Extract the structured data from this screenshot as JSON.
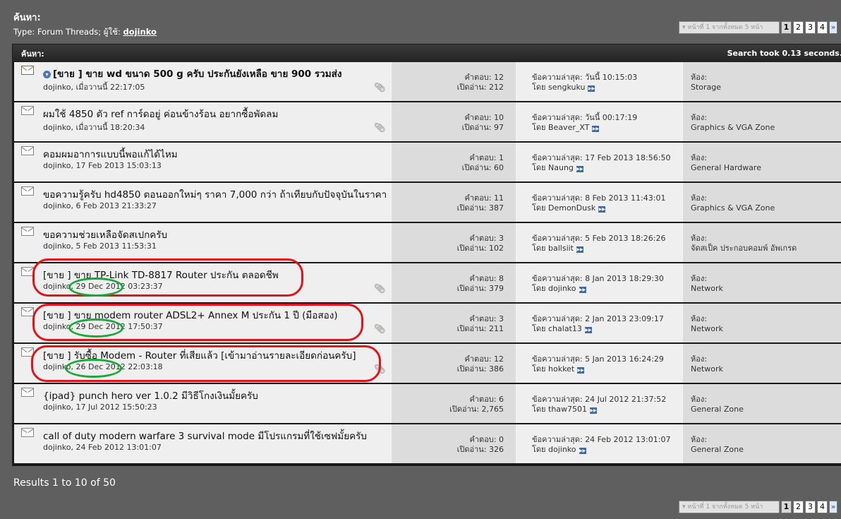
{
  "header": {
    "title": "ค้นหา:",
    "subtitle_prefix": "Type: Forum Threads; ผู้ใช้:",
    "user": "dojinko"
  },
  "pager": {
    "page_text": "หน้าที่ 1 จากทั้งหมด 5 หน้า",
    "pages": [
      "1",
      "2",
      "3",
      "4"
    ],
    "current": "1",
    "next": "»"
  },
  "box": {
    "title": "ค้นหา:",
    "search_time": "Search took 0.13 seconds."
  },
  "labels": {
    "replies": "คำตอบ:",
    "views": "เปิดอ่าน:",
    "last_post": "ข้อความล่าสุด:",
    "by": "โดย",
    "forum": "ห้อง:"
  },
  "threads": [
    {
      "title": "[ขาย ] ขาย wd ขนาด 500 g ครับ ประกันยังเหลือ ขาย 900 รวมส่ง",
      "bold": true,
      "byline": "dojinko, เมื่อวานนี้ 22:17:05",
      "replies": "12",
      "views": "212",
      "last_time": "วันนี้ 10:15:03",
      "last_user": "sengkuku",
      "forum": "Storage",
      "attach": true
    },
    {
      "title": "ผมใช้ 4850 ตัว ref การ์ดอยู่ ค่อนข้างร้อน อยากซื้อพัดลม",
      "byline": "dojinko, เมื่อวานนี้ 18:20:34",
      "replies": "10",
      "views": "97",
      "last_time": "วันนี้ 00:17:19",
      "last_user": "Beaver_XT",
      "forum": "Graphics & VGA Zone",
      "attach": true
    },
    {
      "title": "คอมผมอาการแบบนี้พอแก้ได้ไหม",
      "byline": "dojinko, 17 Feb 2013 15:03:13",
      "replies": "1",
      "views": "60",
      "last_time": "17 Feb 2013 18:56:50",
      "last_user": "Naung",
      "forum": "General Hardware"
    },
    {
      "title": "ขอความรู้ครับ hd4850 ตอนออกใหม่ๆ ราคา 7,000 กว่า ถ้าเทียบกับปัจจุบันในราคา",
      "byline": "dojinko, 6 Feb 2013 21:33:27",
      "replies": "11",
      "views": "387",
      "last_time": "8 Feb 2013 11:43:01",
      "last_user": "DemonDusk",
      "forum": "Graphics & VGA Zone"
    },
    {
      "title": "ขอความช่วยเหลือจัดสเปกครับ",
      "byline": "dojinko, 5 Feb 2013 11:53:31",
      "replies": "3",
      "views": "102",
      "last_time": "5 Feb 2013 18:26:26",
      "last_user": "ballsiit",
      "forum": "จัดสเป็ค ประกอบคอมพ์ อัพเกรด"
    },
    {
      "title": "[ขาย ] ขาย TP-Link TD-8817 Router ประกัน ตลอดชีพ",
      "byline": "dojinko, 29 Dec 2012 03:23:37",
      "replies": "8",
      "views": "379",
      "last_time": "8 Jan 2013 18:29:30",
      "last_user": "dojinko",
      "forum": "Network",
      "attach": true
    },
    {
      "title": "[ขาย ] ขาย modem router ADSL2+ Annex M ประกัน 1 ปี (มือสอง)",
      "byline": "dojinko, 29 Dec 2012 17:50:37",
      "replies": "3",
      "views": "211",
      "last_time": "2 Jan 2013 23:09:17",
      "last_user": "chalat13",
      "forum": "Network",
      "attach": true
    },
    {
      "title": "[ขาย ] รับซื้อ Modem - Router ที่เสียแล้ว [เข้ามาอ่านรายละเอียดก่อนครับ]",
      "byline": "dojinko, 26 Dec 2012 22:03:18",
      "replies": "12",
      "views": "386",
      "last_time": "5 Jan 2013 16:24:29",
      "last_user": "hokket",
      "forum": "Network",
      "attach": true
    },
    {
      "title": "{ipad} punch hero ver 1.0.2 มีวิธีโกงเงินมั้ยครับ",
      "byline": "dojinko, 17 Jul 2012 15:50:23",
      "replies": "6",
      "views": "2,765",
      "last_time": "24 Jul 2012 21:37:52",
      "last_user": "thaw7501",
      "forum": "General Zone"
    },
    {
      "title": "call of duty modern warfare 3 survival mode มีโปรแกรมที่ใช้เซฟมั้ยครับ",
      "byline": "dojinko, 24 Feb 2012 13:01:07",
      "replies": "0",
      "views": "326",
      "last_time": "24 Feb 2012 13:01:07",
      "last_user": "dojinko",
      "forum": "General Zone"
    }
  ],
  "footer": {
    "results": "Results 1 to 10 of 50"
  },
  "colors": {
    "highlight_ring": "#e0141a",
    "date_oval": "#19a93a"
  }
}
